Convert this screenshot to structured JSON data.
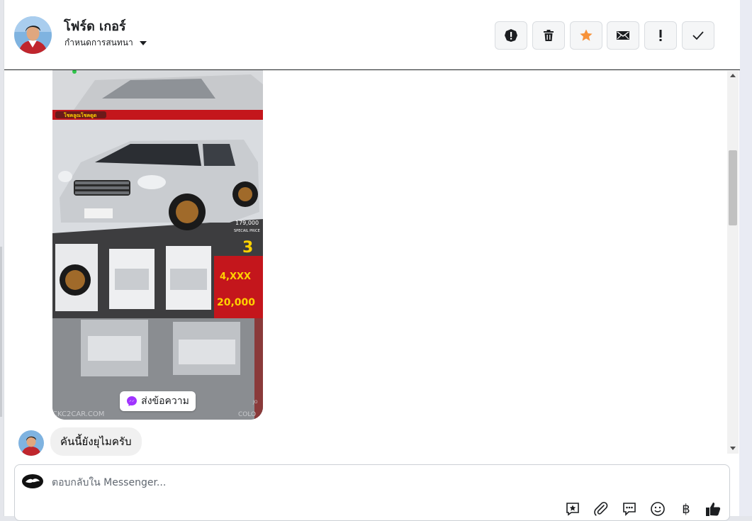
{
  "conversation": {
    "contact_name": "โฟร์ด เกอร์",
    "conversation_menu_label": "กำหนดการสนทนา"
  },
  "toolbar": {
    "buttons": [
      {
        "icon": "alert-circle-icon",
        "label": ""
      },
      {
        "icon": "trash-icon",
        "label": ""
      },
      {
        "icon": "star-icon",
        "label": "",
        "color": "#f7923a"
      },
      {
        "icon": "envelope-icon",
        "label": ""
      },
      {
        "icon": "exclamation-icon",
        "label": ""
      },
      {
        "icon": "check-icon",
        "label": ""
      }
    ]
  },
  "ad_card": {
    "text_lines": [
      "179,000",
      "SPECAIL PRICE",
      "3",
      "4,XXX",
      "20,000",
      "CKC2CAR.COM",
      "COLO",
      "JO"
    ],
    "send_message_label": "ส่งข้อความ"
  },
  "messages": [
    {
      "text": "คันนี้ยังยุไมครับ"
    }
  ],
  "composer": {
    "placeholder": "ตอบกลับใน Messenger...",
    "icons": [
      "saved-reply-icon",
      "attachment-icon",
      "quick-reply-icon",
      "emoji-icon",
      "baht-icon",
      "like-icon"
    ],
    "currency_symbol": "฿"
  },
  "colors": {
    "accent_star": "#f7923a",
    "ad_red": "#c4161c",
    "ad_yellow": "#ffd200"
  }
}
